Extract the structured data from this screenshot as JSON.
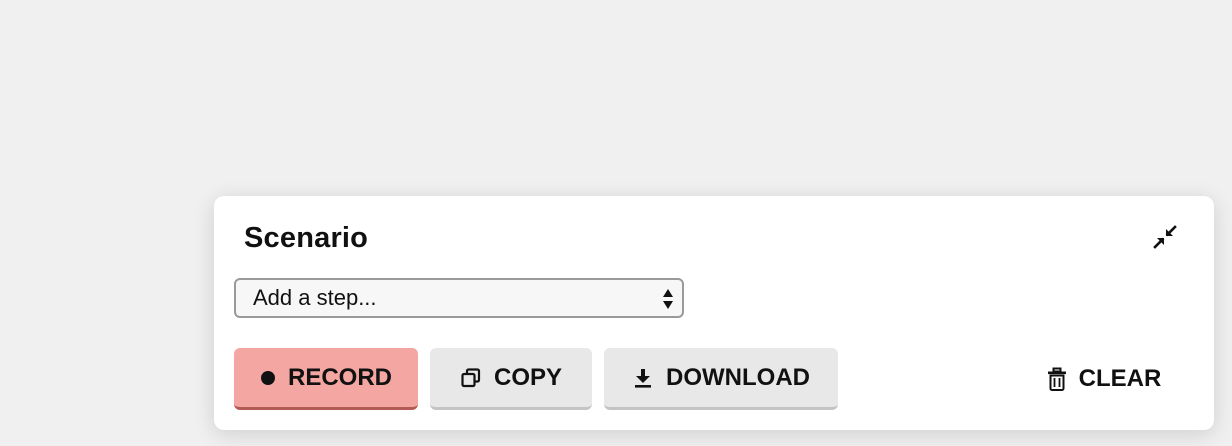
{
  "panel": {
    "title": "Scenario",
    "collapse_icon": "collapse-arrows-icon"
  },
  "step_select": {
    "selected": "Add a step..."
  },
  "buttons": {
    "record": {
      "label": "RECORD",
      "icon": "record-dot-icon",
      "color": "#f4a6a2"
    },
    "copy": {
      "label": "COPY",
      "icon": "copy-icon"
    },
    "download": {
      "label": "DOWNLOAD",
      "icon": "download-icon"
    },
    "clear": {
      "label": "CLEAR",
      "icon": "trash-icon"
    }
  },
  "colors": {
    "background": "#f0f0f0",
    "panel": "#ffffff",
    "record_accent": "#f4a6a2",
    "secondary_button": "#e8e8e8"
  }
}
